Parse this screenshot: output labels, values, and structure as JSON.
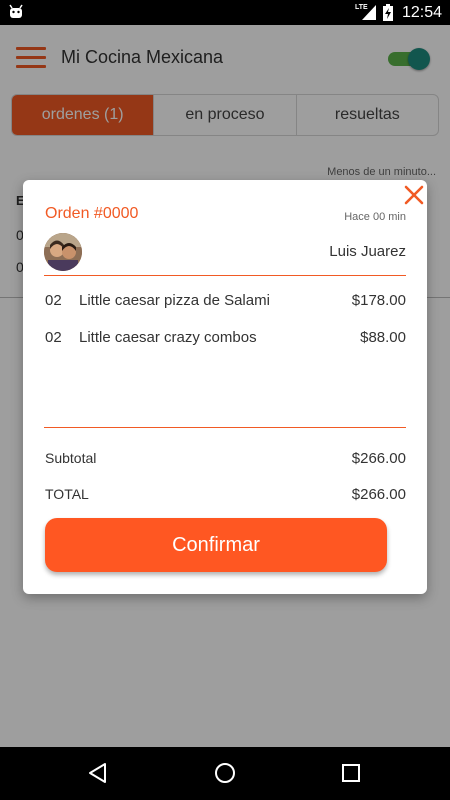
{
  "status_bar": {
    "time": "12:54",
    "network": "LTE",
    "icons": [
      "android-icon",
      "signal-icon",
      "battery-charging-icon"
    ]
  },
  "app_bar": {
    "title": "Mi Cocina Mexicana",
    "menu_icon": "hamburger-menu-icon",
    "toggle_on": true
  },
  "tabs": [
    {
      "label": "ordenes (1)",
      "active": true
    },
    {
      "label": "en proceso",
      "active": false
    },
    {
      "label": "resueltas",
      "active": false
    }
  ],
  "background_list": {
    "time_label": "Menos de un minuto...",
    "row_prefixes": [
      "E",
      "0",
      "0"
    ]
  },
  "dialog": {
    "order_id": "Orden #0000",
    "order_time": "Hace 00 min",
    "customer_name": "Luis Juarez",
    "items": [
      {
        "qty": "02",
        "name": "Little caesar pizza de Salami",
        "price": "$178.00"
      },
      {
        "qty": "02",
        "name": "Little caesar crazy combos",
        "price": "$88.00"
      }
    ],
    "subtotal_label": "Subtotal",
    "subtotal_value": "$266.00",
    "total_label": "TOTAL",
    "total_value": "$266.00",
    "confirm_label": "Confirmar"
  },
  "colors": {
    "accent": "#f15a24",
    "confirm_button": "#ff5722",
    "toggle_track": "#5bb24a",
    "toggle_knob": "#1e8c7e"
  },
  "nav_bar": {
    "icons": [
      "back-icon",
      "home-icon",
      "recents-icon"
    ]
  }
}
